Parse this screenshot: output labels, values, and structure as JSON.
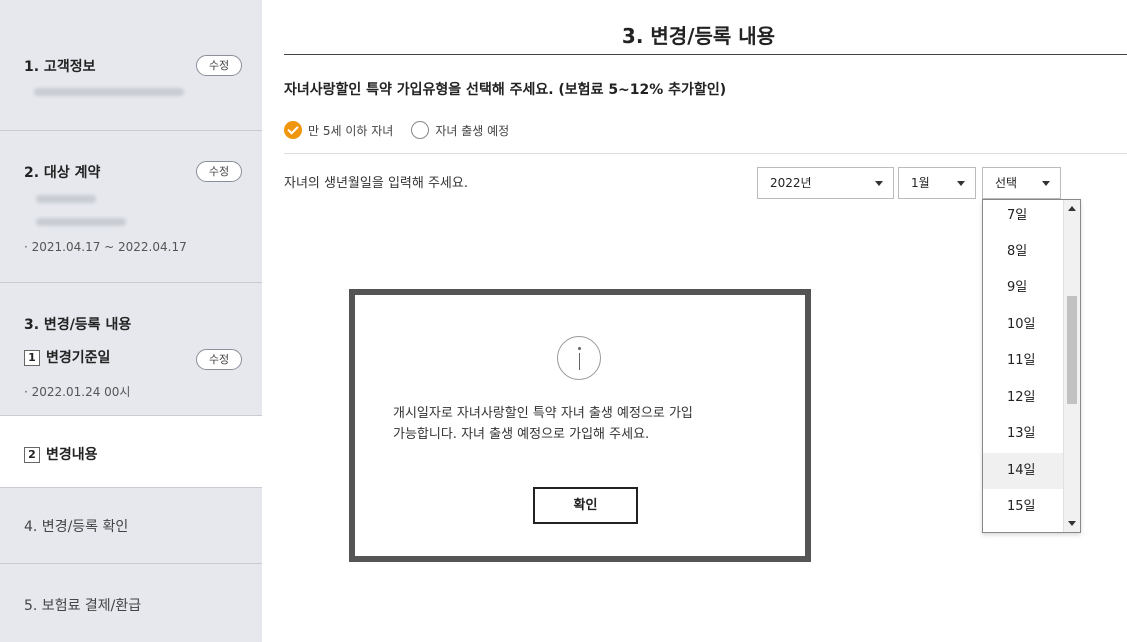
{
  "sidebar": {
    "steps": [
      {
        "title": "1. 고객정보",
        "edit_label": "수정"
      },
      {
        "title": "2. 대상 계약",
        "edit_label": "수정",
        "period": "· 2021.04.17 ~ 2022.04.17"
      },
      {
        "title": "3. 변경/등록 내용",
        "sub1_num": "1",
        "sub1_label": "변경기준일",
        "edit_label": "수정",
        "sub1_value": "· 2022.01.24 00시",
        "sub2_num": "2",
        "sub2_label": "변경내용"
      },
      {
        "title": "4. 변경/등록 확인"
      },
      {
        "title": "5. 보험료 결제/환급"
      }
    ]
  },
  "main": {
    "title": "3. 변경/등록 내용",
    "question": "자녀사랑할인 특약 가입유형을 선택해 주세요. (보험료 5~12% 추가할인)",
    "radio_options": [
      {
        "label": "만 5세 이하 자녀",
        "checked": true
      },
      {
        "label": "자녀 출생 예정",
        "checked": false
      }
    ],
    "birth_label": "자녀의 생년월일을 입력해 주세요.",
    "year_select": "2022년",
    "month_select": "1월",
    "day_select": "선택",
    "day_options": [
      "7일",
      "8일",
      "9일",
      "10일",
      "11일",
      "12일",
      "13일",
      "14일",
      "15일"
    ],
    "day_highlighted": "14일"
  },
  "modal": {
    "icon": "info-icon",
    "message_line1": "개시일자로 자녀사랑할인 특약 자녀 출생 예정으로 가입",
    "message_line2": "가능합니다. 자녀 출생 예정으로 가입해 주세요.",
    "ok_label": "확인"
  },
  "colors": {
    "accent": "#f0960e",
    "sidebar_bg": "#e6e8ee"
  }
}
